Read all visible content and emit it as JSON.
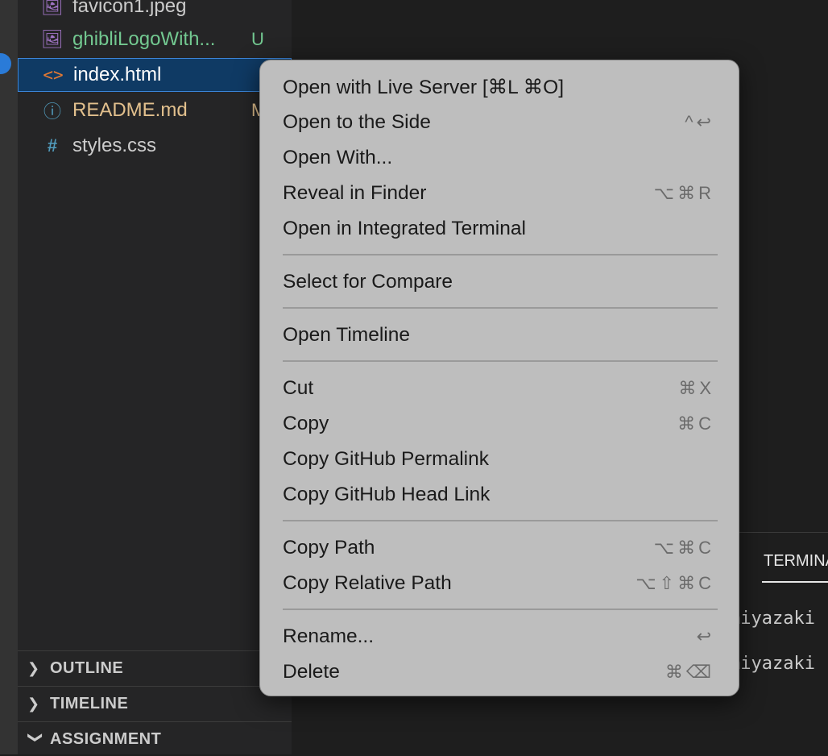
{
  "explorer": {
    "files": [
      {
        "name": "favicon1.jpeg",
        "icon": "image-file-icon",
        "color": "#cccccc",
        "badge": ""
      },
      {
        "name": "ghibliLogoWith...",
        "icon": "image-file-icon",
        "color": "#73c991",
        "badge": "U"
      },
      {
        "name": "index.html",
        "icon": "html-file-icon",
        "color": "#ffffff",
        "badge": ""
      },
      {
        "name": "README.md",
        "icon": "info-file-icon",
        "color": "#e2c08d",
        "badge": "M"
      },
      {
        "name": "styles.css",
        "icon": "css-hash-icon",
        "color": "#cccccc",
        "badge": ""
      }
    ],
    "sections": [
      "OUTLINE",
      "TIMELINE",
      "ASSIGNMENT"
    ]
  },
  "panel": {
    "tab": "TERMINAL",
    "lines": [
      "miyazaki",
      "miyazaki"
    ]
  },
  "context_menu": {
    "items": [
      {
        "label": "Open with Live Server [⌘L ⌘O]",
        "shortcut": ""
      },
      {
        "label": "Open to the Side",
        "shortcut": "^↩"
      },
      {
        "label": "Open With...",
        "shortcut": ""
      },
      {
        "label": "Reveal in Finder",
        "shortcut": "⌥⌘R"
      },
      {
        "label": "Open in Integrated Terminal",
        "shortcut": ""
      },
      {
        "label": "Select for Compare",
        "shortcut": ""
      },
      {
        "label": "Open Timeline",
        "shortcut": ""
      },
      {
        "label": "Cut",
        "shortcut": "⌘X"
      },
      {
        "label": "Copy",
        "shortcut": "⌘C"
      },
      {
        "label": "Copy GitHub Permalink",
        "shortcut": ""
      },
      {
        "label": "Copy GitHub Head Link",
        "shortcut": ""
      },
      {
        "label": "Copy Path",
        "shortcut": "⌥⌘C"
      },
      {
        "label": "Copy Relative Path",
        "shortcut": "⌥⇧⌘C"
      },
      {
        "label": "Rename...",
        "shortcut": "↩"
      },
      {
        "label": "Delete",
        "shortcut": "⌘⌫"
      }
    ]
  },
  "colors": {
    "accent": "#3b83d6",
    "selected_row": "#0f3a64",
    "menu_bg": "#bebebe",
    "untracked": "#73c991",
    "modified": "#e2c08d"
  }
}
